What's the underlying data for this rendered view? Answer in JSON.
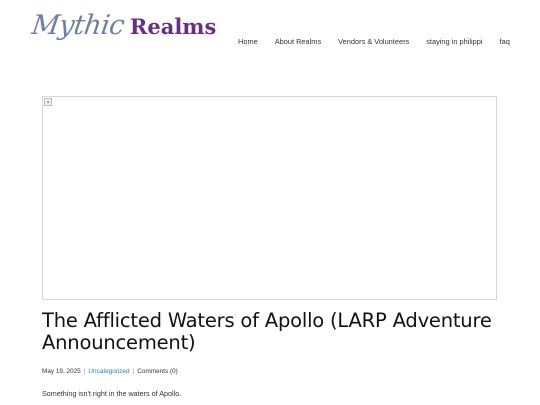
{
  "brand": {
    "script": "Mythic",
    "bold": "Realms"
  },
  "nav": {
    "items": [
      {
        "label": "Home"
      },
      {
        "label": "About Realms"
      },
      {
        "label": "Vendors & Volunteers"
      },
      {
        "label": "staying in philippi"
      },
      {
        "label": "faq"
      }
    ]
  },
  "post": {
    "title": "The Afflicted Waters of Apollo (LARP Adventure Announcement)",
    "date": "May 19, 2025",
    "category": "Uncategorized",
    "comments": "Comments (0)",
    "excerpt": "Something isn't right in the waters of Apollo."
  },
  "colors": {
    "logo_script": "#6c7fa6",
    "logo_bold": "#6a2d86",
    "link": "#2b7bb9"
  },
  "icons": {
    "featured_image": "broken-image-icon"
  }
}
